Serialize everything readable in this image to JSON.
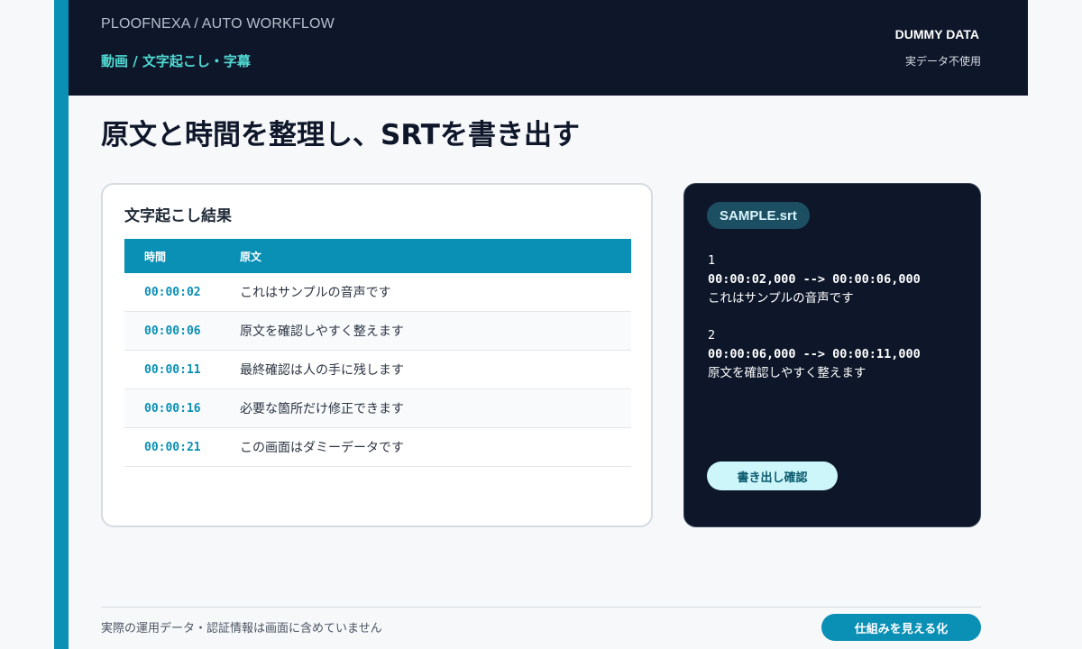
{
  "header": {
    "brand": "PLOOFNEXA / AUTO WORKFLOW",
    "section": "動画 / 文字起こし・字幕",
    "badge": "DUMMY DATA",
    "badge_note": "実データ不使用"
  },
  "page_title": "原文と時間を整理し、SRTを書き出す",
  "transcript": {
    "title": "文字起こし結果",
    "columns": [
      "時間",
      "原文"
    ],
    "rows": [
      {
        "time": "00:00:02",
        "text": "これはサンプルの音声です"
      },
      {
        "time": "00:00:06",
        "text": "原文を確認しやすく整えます"
      },
      {
        "time": "00:00:11",
        "text": "最終確認は人の手に残します"
      },
      {
        "time": "00:00:16",
        "text": "必要な箇所だけ修正できます"
      },
      {
        "time": "00:00:21",
        "text": "この画面はダミーデータです"
      }
    ]
  },
  "srt": {
    "file_name": "SAMPLE.srt",
    "entries": [
      {
        "index": "1",
        "timing": "00:00:02,000 --> 00:00:06,000",
        "text": "これはサンプルの音声です"
      },
      {
        "index": "2",
        "timing": "00:00:06,000 --> 00:00:11,000",
        "text": "原文を確認しやすく整えます"
      }
    ],
    "export_label": "書き出し確認"
  },
  "footer": {
    "note": "実際の運用データ・認証情報は画面に含めていません",
    "button_label": "仕組みを見える化"
  },
  "colors": {
    "accent": "#0a8fb5",
    "header_bg": "#0e172a",
    "section_text": "#4fdbd4"
  }
}
